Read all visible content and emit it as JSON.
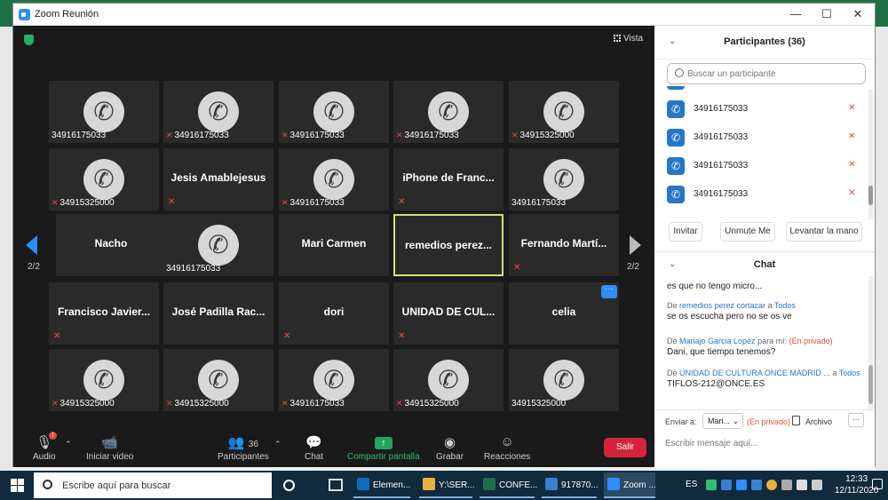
{
  "window": {
    "title": "Zoom Reunión",
    "min": "—",
    "max": "☐",
    "close": "✕"
  },
  "stage": {
    "view_label": "Vista",
    "page_left": "2/2",
    "page_right": "2/2",
    "more_label": "···",
    "tiles": [
      {
        "label": "34916175033",
        "type": "phone",
        "muted": false
      },
      {
        "label": "34916175033",
        "type": "phone",
        "muted": true
      },
      {
        "label": "34916175033",
        "type": "phone",
        "muted": true
      },
      {
        "label": "34916175033",
        "type": "phone",
        "muted": true
      },
      {
        "label": "34915325000",
        "type": "phone",
        "muted": true
      },
      {
        "label": "34915325000",
        "type": "phone",
        "muted": true
      },
      {
        "label": "Jesis Amablejesus",
        "type": "name",
        "muted": true
      },
      {
        "label": "34916175033",
        "type": "phone",
        "muted": true
      },
      {
        "label": "iPhone de Franc...",
        "type": "name",
        "muted": true
      },
      {
        "label": "34916175033",
        "type": "phone",
        "muted": false
      },
      {
        "label": "Nacho",
        "type": "name",
        "muted": false
      },
      {
        "label": "34916175033",
        "type": "phone",
        "muted": false
      },
      {
        "label": "Mari Carmen",
        "type": "name",
        "muted": false
      },
      {
        "label": "remedios perez...",
        "type": "name",
        "muted": false,
        "active": true
      },
      {
        "label": "Fernando Martí...",
        "type": "name",
        "muted": true
      },
      {
        "label": "Francisco Javier...",
        "type": "name",
        "muted": true
      },
      {
        "label": "José Padilla Rac...",
        "type": "name",
        "muted": false
      },
      {
        "label": "dori",
        "type": "name",
        "muted": true
      },
      {
        "label": "UNIDAD DE CUL...",
        "type": "name",
        "muted": true
      },
      {
        "label": "celia",
        "type": "name",
        "muted": false
      },
      {
        "label": "34915325000",
        "type": "phone",
        "muted": true
      },
      {
        "label": "34915325000",
        "type": "phone",
        "muted": true
      },
      {
        "label": "34916175033",
        "type": "phone",
        "muted": true
      },
      {
        "label": "34915325000",
        "type": "phone",
        "muted": true
      },
      {
        "label": "34915325000",
        "type": "phone",
        "muted": false
      }
    ]
  },
  "toolbar": {
    "audio": "Audio",
    "video": "Iniciar video",
    "participants": "Participantes",
    "participants_count": "36",
    "chat": "Chat",
    "share": "Compartir pantalla",
    "record": "Grabar",
    "reactions": "Reacciones",
    "leave": "Salir",
    "audio_badge": "!"
  },
  "participants_panel": {
    "title": "Participantes (36)",
    "search_placeholder": "Buscar un participante",
    "items": [
      {
        "name": "34916175033"
      },
      {
        "name": "34916175033"
      },
      {
        "name": "34916175033"
      },
      {
        "name": "34916175033"
      }
    ],
    "buttons": {
      "invite": "Invitar",
      "unmute": "Unmute Me",
      "raise": "Levantar la mano"
    }
  },
  "chat": {
    "title": "Chat",
    "messages": [
      {
        "meta_prefix": "",
        "sender": "",
        "middle": "",
        "target": "",
        "private": "",
        "text": "es que no tengo micro..."
      },
      {
        "meta_prefix": "De ",
        "sender": "remedios perez cortazar",
        "middle": " a ",
        "target": "Todos",
        "private": "",
        "text": "se os escucha pero no se os ve"
      },
      {
        "meta_prefix": "De ",
        "sender": "Mariajo Garcia Lopez",
        "middle": " para mí: ",
        "target": "",
        "private": "(En privado)",
        "text": "Dani, que tiempo tenemos?"
      },
      {
        "meta_prefix": "De ",
        "sender": "UNIDAD DE CULTURA ONCE MADRID ...",
        "middle": " a ",
        "target": "Todos",
        "private": "",
        "text": "TIFLOS-212@ONCE.ES"
      }
    ],
    "send_to_label": "Enviar a:",
    "send_to_value": "Mari...",
    "private_label": "(En privado)",
    "file_label": "Archivo",
    "more": "···",
    "input_placeholder": "Escribir mensaje aquí..."
  },
  "taskbar": {
    "search_placeholder": "Escribe aquí para buscar",
    "apps": [
      {
        "label": "Elemen...",
        "color": "#0f6cbd"
      },
      {
        "label": "Y:\\SER...",
        "color": "#e8b33a"
      },
      {
        "label": "CONFE...",
        "color": "#1e7145"
      },
      {
        "label": "917870...",
        "color": "#3b7fd1"
      },
      {
        "label": "Zoom ...",
        "color": "#2d8cff"
      }
    ],
    "lang": "ES",
    "time": "12:33",
    "date": "12/11/2020"
  }
}
